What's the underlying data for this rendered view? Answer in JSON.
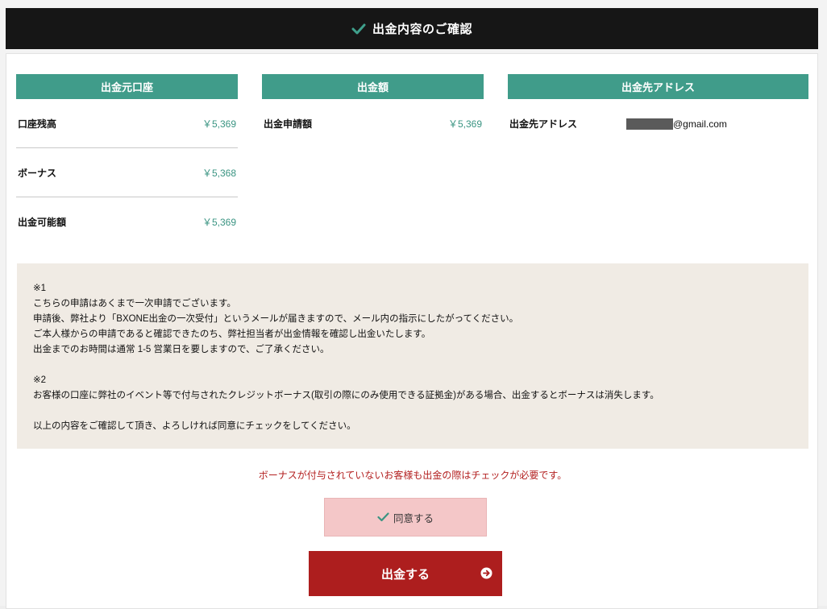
{
  "header": {
    "title": "出金内容のご確認",
    "icon": "check-icon"
  },
  "source_account": {
    "heading": "出金元口座",
    "rows": [
      {
        "label": "口座残高",
        "value": "￥5,369"
      },
      {
        "label": "ボーナス",
        "value": "￥5,368"
      },
      {
        "label": "出金可能額",
        "value": "￥5,369"
      }
    ]
  },
  "amount": {
    "heading": "出金額",
    "rows": [
      {
        "label": "出金申請額",
        "value": "￥5,369"
      }
    ]
  },
  "destination": {
    "heading": "出金先アドレス",
    "label": "出金先アドレス",
    "email_suffix": "@gmail.com"
  },
  "notice": {
    "mark1": "※1",
    "line1": "こちらの申請はあくまで一次申請でございます。",
    "line2": "申請後、弊社より「BXONE出金の一次受付」というメールが届きますので、メール内の指示にしたがってください。",
    "line3": "ご本人様からの申請であると確認できたのち、弊社担当者が出金情報を確認し出金いたします。",
    "line4": "出金までのお時間は通常 1-5 営業日を要しますので、ご了承ください。",
    "mark2": "※2",
    "line5": "お客様の口座に弊社のイベント等で付与されたクレジットボーナス(取引の際にのみ使用できる証拠金)がある場合、出金するとボーナスは消失します。",
    "line6": "以上の内容をご確認して頂き、よろしければ同意にチェックをしてください。"
  },
  "warning": "ボーナスが付与されていないお客様も出金の際はチェックが必要です。",
  "agree_label": "同意する",
  "submit_label": "出金する",
  "colors": {
    "accent": "#409c8a",
    "header_bg": "#161616",
    "submit_bg": "#ad1e1e",
    "agree_bg": "#f4c7c8",
    "warning": "#b32020",
    "note_bg": "#f0ebe4"
  }
}
